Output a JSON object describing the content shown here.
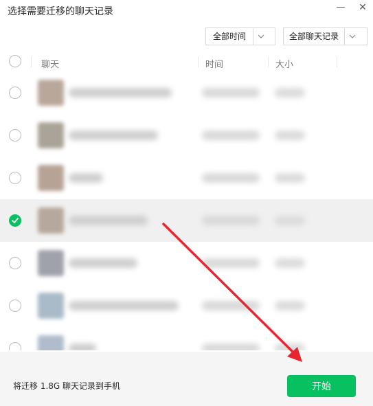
{
  "window": {
    "title": "选择需要迁移的聊天记录",
    "minimize_glyph": "—",
    "close_glyph": "✕"
  },
  "filters": {
    "time_label": "全部时间",
    "chat_label": "全部聊天记录"
  },
  "table": {
    "columns": [
      "聊天",
      "时间",
      "大小"
    ],
    "rows": [
      {
        "selected": false,
        "name_width": 150,
        "avatar_color": "#b9a79a"
      },
      {
        "selected": false,
        "name_width": 130,
        "avatar_color": "#aaa397"
      },
      {
        "selected": false,
        "name_width": 50,
        "avatar_color": "#b7a395"
      },
      {
        "selected": true,
        "name_width": 115,
        "avatar_color": "#b6a89c"
      },
      {
        "selected": false,
        "name_width": 100,
        "avatar_color": "#9fa1ab"
      },
      {
        "selected": false,
        "name_width": 160,
        "avatar_color": "#a9bac8"
      },
      {
        "selected": false,
        "name_width": 40,
        "avatar_color": "#b0bccc"
      }
    ]
  },
  "footer": {
    "summary": "将迁移 1.8G 聊天记录到手机",
    "start_label": "开始"
  },
  "colors": {
    "accent": "#07c160",
    "annotation_arrow": "#e8262f"
  },
  "icons": [
    "minimize-icon",
    "close-icon",
    "chevron-down-icon",
    "checkmark-icon",
    "annotation-arrow"
  ]
}
